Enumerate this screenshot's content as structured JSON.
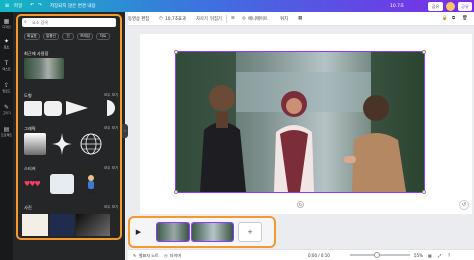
{
  "header": {
    "home_label": "파일",
    "doc_title": "저장되지 않은 변경 내용",
    "share_label": "공유",
    "publish_label": "공유",
    "duration_label": "10.7초"
  },
  "toolbar": {
    "edit_label": "동영상 편집",
    "duration": "10.7초",
    "effects": "효과",
    "crop": "자르기",
    "flip": "뒤집기",
    "animate": "애니메이트",
    "position": "위치"
  },
  "rail": {
    "items": [
      {
        "icon": "template-icon",
        "label": "디자인"
      },
      {
        "icon": "elements-icon",
        "label": "요소"
      },
      {
        "icon": "text-icon",
        "label": "텍스트"
      },
      {
        "icon": "upload-icon",
        "label": "업로드"
      },
      {
        "icon": "draw-icon",
        "label": "그리기"
      },
      {
        "icon": "projects-icon",
        "label": "프로젝트"
      }
    ]
  },
  "panel": {
    "search_placeholder": "요소 검색",
    "chips": [
      "화살표",
      "말풍선",
      "선",
      "프레임",
      "차트"
    ],
    "sections": {
      "recent": "최근에 사용함",
      "shapes": "도형",
      "graphics": "그래픽",
      "stickers": "스티커",
      "photos": "사진"
    },
    "see_all": "모두 보기"
  },
  "timeline": {
    "add_label": "+"
  },
  "bottom": {
    "notes": "발표자 노트",
    "timer": "타이머",
    "time_display": "0:00 / 0:10",
    "zoom": "55%"
  },
  "colors": {
    "accent": "#8b3dff",
    "highlight": "#f29a2e",
    "panel_bg": "#252627",
    "rail_bg": "#18191b"
  }
}
